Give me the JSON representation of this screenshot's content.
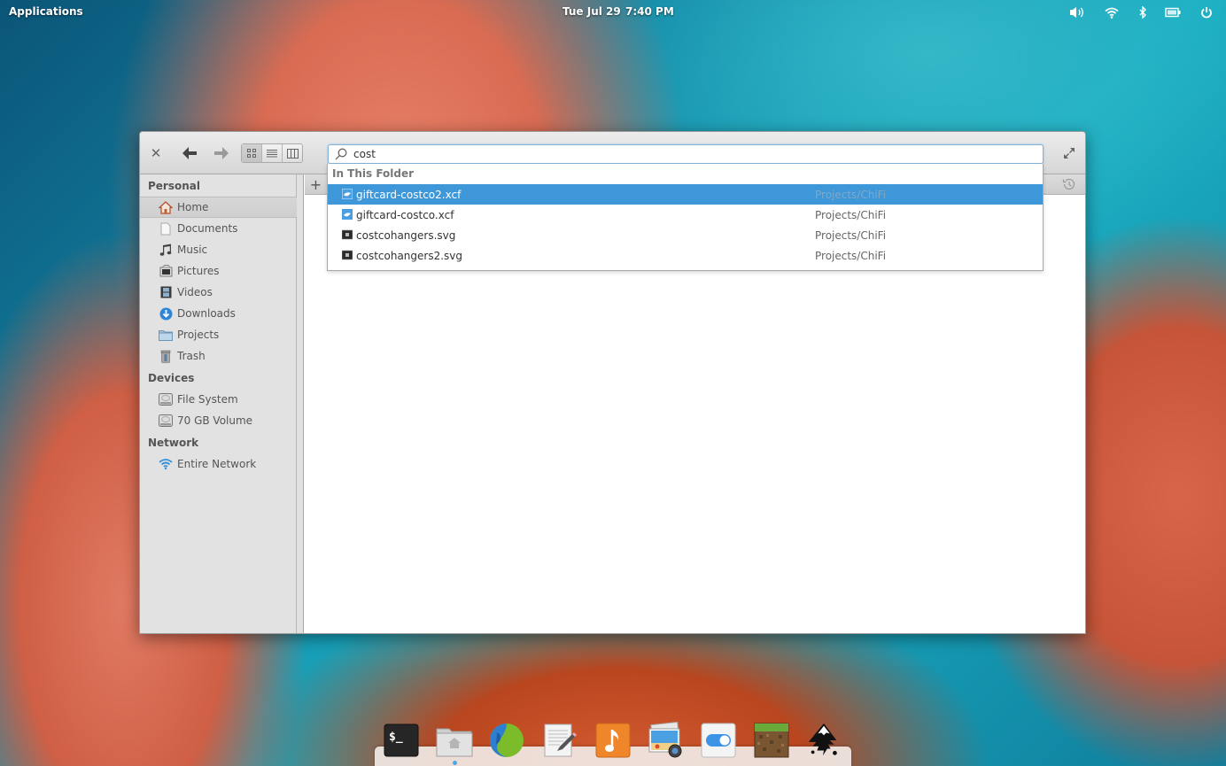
{
  "panel": {
    "applications_label": "Applications",
    "date": "Tue Jul 29",
    "time": "7:40 PM",
    "indicators": [
      "volume-icon",
      "wifi-icon",
      "bluetooth-icon",
      "battery-icon",
      "power-icon"
    ]
  },
  "window": {
    "toolbar": {
      "close_icon": "close-icon",
      "back_icon": "arrow-left-icon",
      "forward_icon": "arrow-right-icon",
      "view_modes": [
        "grid-view",
        "list-view",
        "column-view"
      ],
      "active_view": "grid-view",
      "maximize_icon": "maximize-icon"
    },
    "search": {
      "value": "cost",
      "placeholder": ""
    },
    "sidebar": {
      "sections": [
        {
          "heading": "Personal",
          "items": [
            {
              "label": "Home",
              "icon": "home-icon",
              "selected": true
            },
            {
              "label": "Documents",
              "icon": "document-icon"
            },
            {
              "label": "Music",
              "icon": "music-icon"
            },
            {
              "label": "Pictures",
              "icon": "pictures-icon"
            },
            {
              "label": "Videos",
              "icon": "video-icon"
            },
            {
              "label": "Downloads",
              "icon": "download-icon"
            },
            {
              "label": "Projects",
              "icon": "folder-icon"
            },
            {
              "label": "Trash",
              "icon": "trash-icon"
            }
          ]
        },
        {
          "heading": "Devices",
          "items": [
            {
              "label": "File System",
              "icon": "drive-icon"
            },
            {
              "label": "70 GB Volume",
              "icon": "drive-icon"
            }
          ]
        },
        {
          "heading": "Network",
          "items": [
            {
              "label": "Entire Network",
              "icon": "network-icon"
            }
          ]
        }
      ]
    },
    "tabbar": {
      "new_tab_label": "+",
      "history_icon": "history-icon"
    },
    "search_results": {
      "heading": "In This Folder",
      "items": [
        {
          "name": "giftcard-costco2.xcf",
          "path": "Projects/ChiFi",
          "type": "xcf",
          "selected": true
        },
        {
          "name": "giftcard-costco.xcf",
          "path": "Projects/ChiFi",
          "type": "xcf"
        },
        {
          "name": "costcohangers.svg",
          "path": "Projects/ChiFi",
          "type": "svg"
        },
        {
          "name": "costcohangers2.svg",
          "path": "Projects/ChiFi",
          "type": "svg"
        }
      ]
    }
  },
  "dock": {
    "apps": [
      {
        "name": "Terminal",
        "icon": "terminal-icon"
      },
      {
        "name": "Files",
        "icon": "files-icon",
        "running": true
      },
      {
        "name": "Web Browser",
        "icon": "browser-icon"
      },
      {
        "name": "Scratch",
        "icon": "text-editor-icon"
      },
      {
        "name": "Music",
        "icon": "music-app-icon"
      },
      {
        "name": "Shotwell",
        "icon": "photos-icon"
      },
      {
        "name": "Settings",
        "icon": "settings-toggle-icon"
      },
      {
        "name": "Minecraft",
        "icon": "minecraft-icon"
      },
      {
        "name": "Inkscape",
        "icon": "inkscape-icon"
      }
    ]
  }
}
